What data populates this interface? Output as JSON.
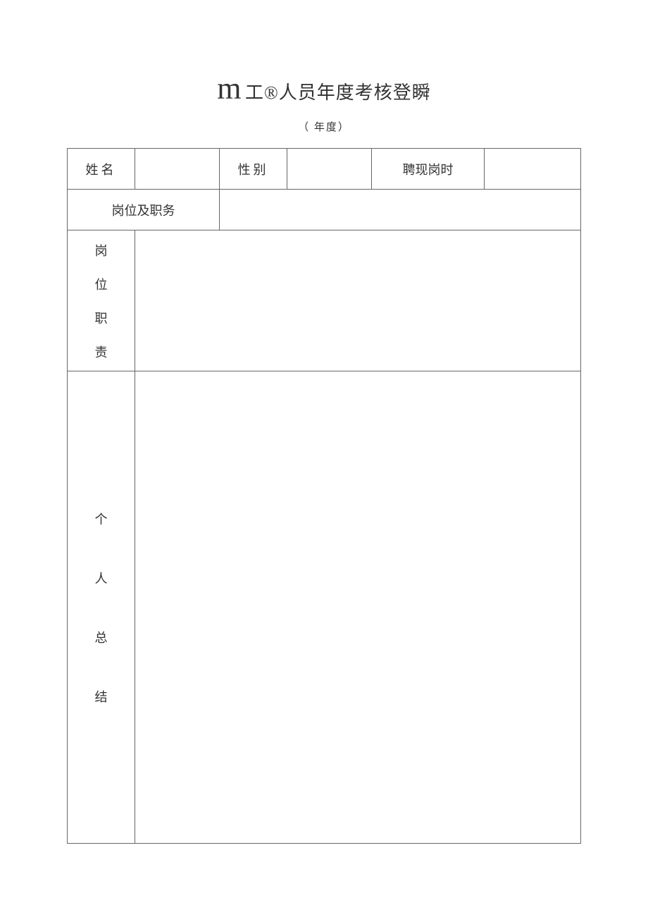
{
  "title": {
    "prefix": "m",
    "text": " 工®人员年度考核登瞬"
  },
  "subtitle": "（ 年度）",
  "fields": {
    "name_label": "姓名",
    "name_value": "",
    "gender_label": "性别",
    "gender_value": "",
    "hire_time_label": "聘现岗时",
    "hire_time_value": "",
    "position_label": "岗位及职务",
    "position_value": "",
    "duties_chars": [
      "岗",
      "位",
      "职",
      "责"
    ],
    "duties_value": "",
    "summary_chars": [
      "个",
      "人",
      "总",
      "结"
    ],
    "summary_value": ""
  }
}
